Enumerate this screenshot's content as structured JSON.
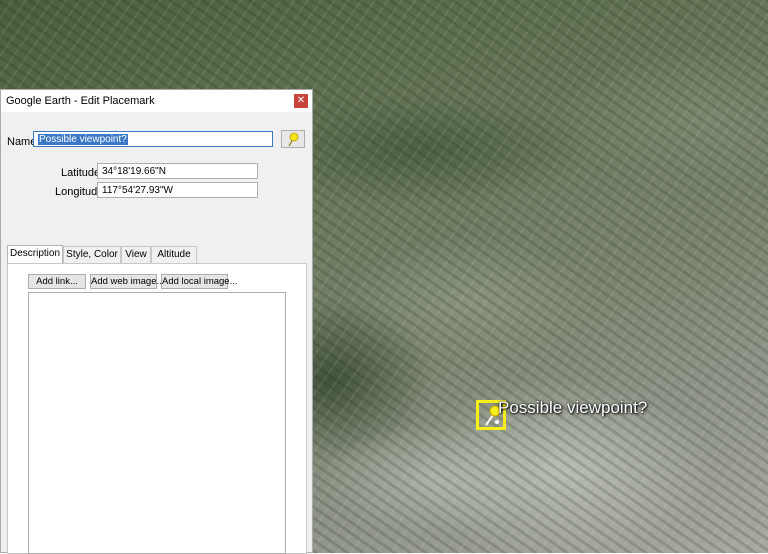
{
  "map": {
    "placemark_label": "Possible viewpoint?",
    "placemark_color": "#f7ef1a"
  },
  "dialog": {
    "title": "Google Earth - Edit Placemark",
    "close_icon": "close-icon",
    "name_label": "Name:",
    "name_value": "Possible viewpoint?",
    "pin_icon": "yellow-pushpin-icon",
    "latitude_label": "Latitude:",
    "latitude_value": "34°18'19.66\"N",
    "longitude_label": "Longitude:",
    "longitude_value": "117°54'27.93\"W",
    "tabs": [
      {
        "label": "Description",
        "active": true
      },
      {
        "label": "Style, Color",
        "active": false
      },
      {
        "label": "View",
        "active": false
      },
      {
        "label": "Altitude",
        "active": false
      }
    ],
    "buttons": {
      "add_link": "Add link...",
      "add_web_image": "Add web image...",
      "add_local_image": "Add local image..."
    },
    "description_value": ""
  }
}
